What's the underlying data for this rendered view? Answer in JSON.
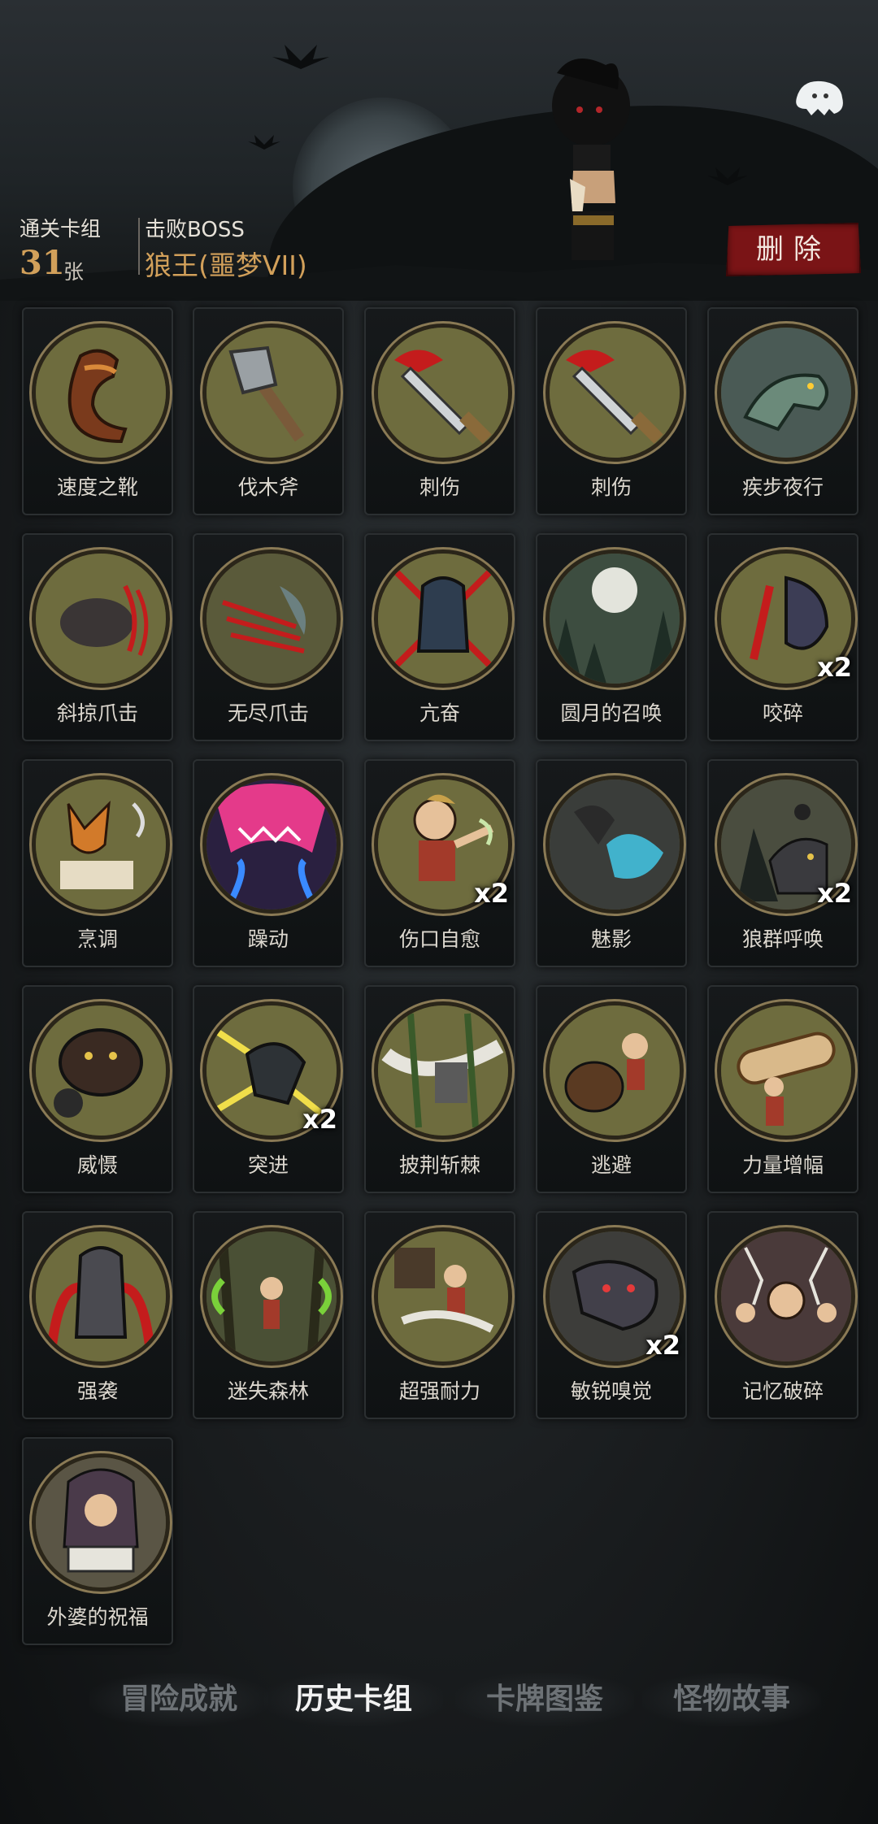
{
  "header": {
    "deck_label": "通关卡组",
    "deck_count": "31",
    "deck_unit": "张",
    "boss_label": "击败BOSS",
    "boss_name": "狼王(噩梦VII)",
    "delete_label": "删除"
  },
  "cards": [
    {
      "name": "速度之靴",
      "icon": "boot-icon",
      "count": ""
    },
    {
      "name": "伐木斧",
      "icon": "axe-icon",
      "count": ""
    },
    {
      "name": "刺伤",
      "icon": "bloody-knife-icon",
      "count": ""
    },
    {
      "name": "刺伤",
      "icon": "bloody-knife-icon",
      "count": ""
    },
    {
      "name": "疾步夜行",
      "icon": "wolf-running-icon",
      "count": ""
    },
    {
      "name": "斜掠爪击",
      "icon": "wolf-claw-icon",
      "count": ""
    },
    {
      "name": "无尽爪击",
      "icon": "claw-slash-icon",
      "count": ""
    },
    {
      "name": "亢奋",
      "icon": "werewolf-rage-icon",
      "count": ""
    },
    {
      "name": "圆月的召唤",
      "icon": "full-moon-icon",
      "count": ""
    },
    {
      "name": "咬碎",
      "icon": "wolf-bite-icon",
      "count": "x2"
    },
    {
      "name": "烹调",
      "icon": "fox-cook-icon",
      "count": ""
    },
    {
      "name": "躁动",
      "icon": "frenzy-icon",
      "count": ""
    },
    {
      "name": "伤口自愈",
      "icon": "boy-heal-icon",
      "count": "x2"
    },
    {
      "name": "魅影",
      "icon": "phantom-wolf-icon",
      "count": ""
    },
    {
      "name": "狼群呼唤",
      "icon": "wolf-pack-icon",
      "count": "x2"
    },
    {
      "name": "威慑",
      "icon": "bear-roar-icon",
      "count": ""
    },
    {
      "name": "突进",
      "icon": "wolf-dash-icon",
      "count": "x2"
    },
    {
      "name": "披荆斩棘",
      "icon": "thorn-slash-icon",
      "count": ""
    },
    {
      "name": "逃避",
      "icon": "boy-flee-icon",
      "count": ""
    },
    {
      "name": "力量增幅",
      "icon": "log-lift-icon",
      "count": ""
    },
    {
      "name": "强袭",
      "icon": "werewolf-assault-icon",
      "count": ""
    },
    {
      "name": "迷失森林",
      "icon": "lost-forest-icon",
      "count": ""
    },
    {
      "name": "超强耐力",
      "icon": "boy-swing-icon",
      "count": ""
    },
    {
      "name": "敏锐嗅觉",
      "icon": "wolf-sniff-icon",
      "count": "x2"
    },
    {
      "name": "记忆破碎",
      "icon": "memory-shatter-icon",
      "count": ""
    },
    {
      "name": "外婆的祝福",
      "icon": "grandma-book-icon",
      "count": ""
    }
  ],
  "tabs": [
    {
      "label": "冒险成就",
      "active": false
    },
    {
      "label": "历史卡组",
      "active": true
    },
    {
      "label": "卡牌图鉴",
      "active": false
    },
    {
      "label": "怪物故事",
      "active": false
    }
  ],
  "colors": {
    "accent_gold": "#d2a05a",
    "delete_red": "#7a1416",
    "card_bg": "#6e6c3e"
  }
}
